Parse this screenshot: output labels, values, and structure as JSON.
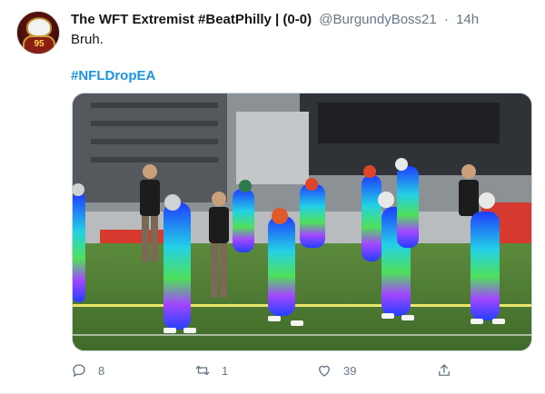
{
  "tweet": {
    "display_name": "The WFT Extremist #BeatPhilly | (0-0)",
    "handle": "@BurgundyBoss21",
    "separator": "·",
    "time": "14h",
    "text": "Bruh.",
    "hashtag": "#NFLDropEA",
    "avatar_number": "95"
  },
  "actions": {
    "reply_count": "8",
    "retweet_count": "1",
    "like_count": "39",
    "share_icon": "share-icon"
  },
  "colors": {
    "link": "#1b95e0",
    "muted": "#657786",
    "text": "#14171a"
  }
}
